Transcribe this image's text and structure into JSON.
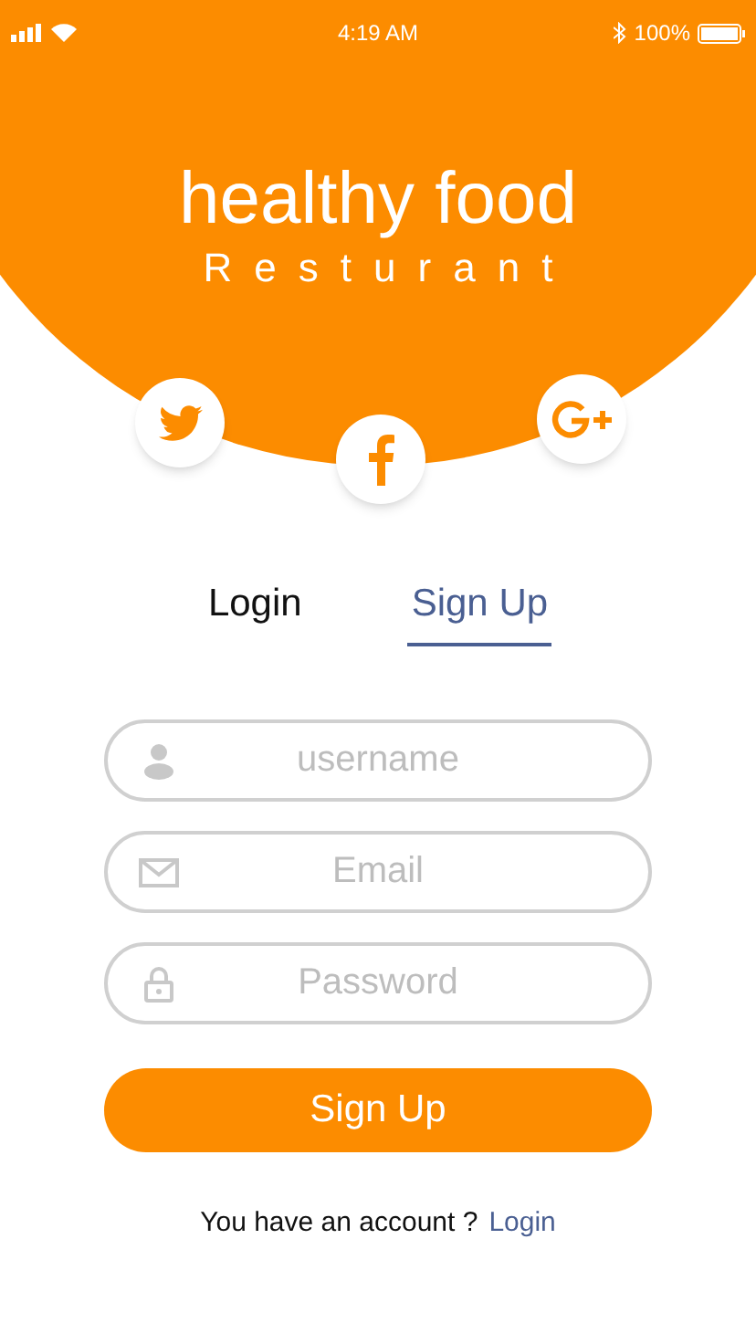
{
  "status_bar": {
    "time": "4:19 AM",
    "battery": "100%"
  },
  "header": {
    "title": "healthy food",
    "subtitle": "Resturant"
  },
  "social": [
    {
      "kind": "twitter"
    },
    {
      "kind": "facebook"
    },
    {
      "kind": "googleplus"
    }
  ],
  "tabs": [
    {
      "label": "Login",
      "selected": false
    },
    {
      "label": "Sign Up",
      "selected": true
    }
  ],
  "fields": [
    {
      "kind": "user",
      "placeholder": "username"
    },
    {
      "kind": "email",
      "placeholder": "Email"
    },
    {
      "kind": "password",
      "placeholder": "Password"
    }
  ],
  "submit_button": "Sign Up",
  "footer": {
    "text": "You have an account ?",
    "link": "Login"
  }
}
